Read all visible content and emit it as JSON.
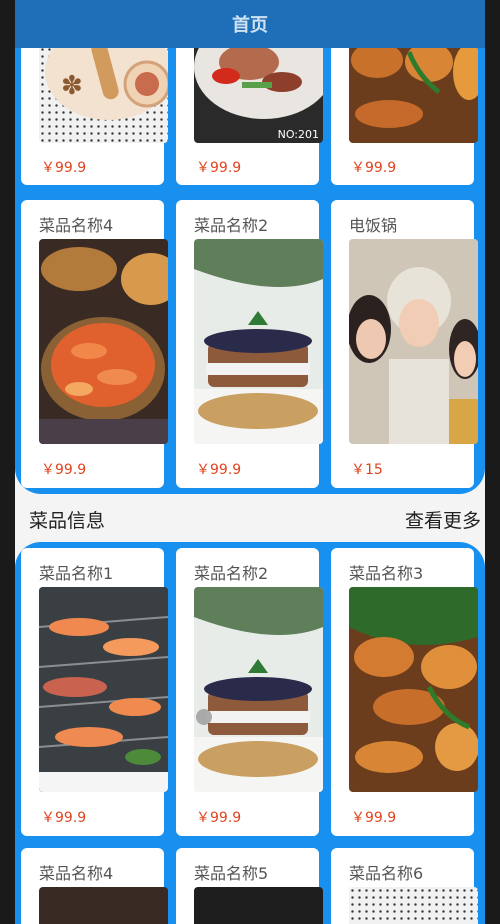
{
  "header": {
    "title": "首页"
  },
  "top_panel": {
    "partial_cards": [
      {
        "price": "￥99.9"
      },
      {
        "price": "￥99.9",
        "watermark": "NO:201"
      },
      {
        "price": "￥99.9"
      }
    ],
    "cards": [
      {
        "name": "菜品名称4",
        "price": "￥99.9"
      },
      {
        "name": "菜品名称2",
        "price": "￥99.9"
      },
      {
        "name": "电饭锅",
        "price": "￥15"
      }
    ]
  },
  "section": {
    "title": "菜品信息",
    "more": "查看更多"
  },
  "bottom_panel": {
    "cards": [
      {
        "name": "菜品名称1",
        "price": "￥99.9"
      },
      {
        "name": "菜品名称2",
        "price": "￥99.9"
      },
      {
        "name": "菜品名称3",
        "price": "￥99.9"
      }
    ],
    "partial_cards": [
      {
        "name": "菜品名称4"
      },
      {
        "name": "菜品名称5"
      },
      {
        "name": "菜品名称6"
      }
    ]
  },
  "colors": {
    "panel": "#1890f0",
    "price": "#e0441f",
    "header": "#1e6fb8"
  }
}
